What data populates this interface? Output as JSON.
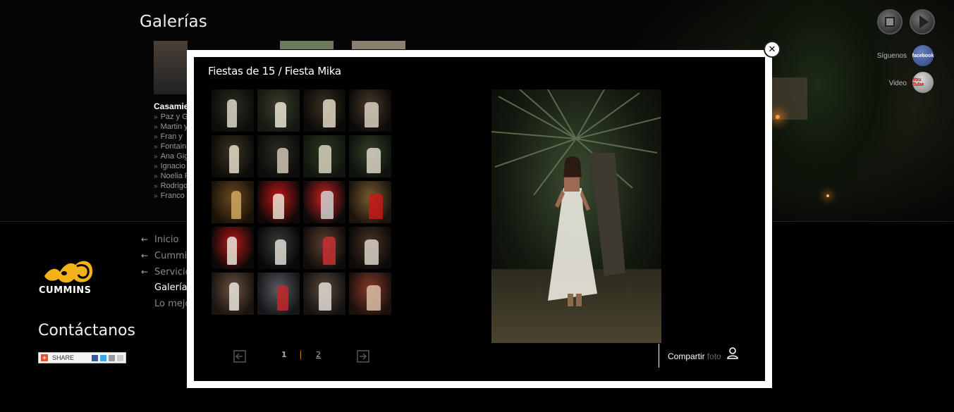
{
  "page": {
    "title": "Galerías"
  },
  "category": {
    "heading": "Casamie",
    "items": [
      "Paz y G",
      "Martin y",
      "Fran y",
      "Fontain",
      "Ana Gig",
      "Ignacio",
      "Noelia F",
      "Rodrigo",
      "Franco"
    ]
  },
  "player": {
    "stop_label": "stop",
    "play_label": "play"
  },
  "social": {
    "follow_label": "Síguenos",
    "facebook_text": "facebook",
    "video_label": "Video",
    "youtube_text": "You Tube"
  },
  "nav": {
    "items": [
      {
        "label": "Inicio",
        "arrow": "←"
      },
      {
        "label": "Cummi",
        "arrow": "←"
      },
      {
        "label": "Servicio",
        "arrow": "←"
      },
      {
        "label": "Galería",
        "arrow": ""
      },
      {
        "label": "Lo mejo",
        "arrow": ""
      }
    ]
  },
  "brand": {
    "logo_text": "CUMMINS",
    "logo_icon": "cummins-logo-icon"
  },
  "contact": {
    "heading": "Contáctanos"
  },
  "share_widget": {
    "label": "SHARE"
  },
  "modal": {
    "title": "Fiestas de 15 / Fiesta Mika",
    "close_glyph": "✕",
    "pager": {
      "current": "1",
      "next_page": "2"
    },
    "share_label": "Compartir",
    "share_label_dim": "foto"
  },
  "thumbnails": [
    "night-garden",
    "night-garden",
    "girl-white-dress",
    "girl-portrait",
    "girl-pose",
    "girl-closeup",
    "girl-leaning",
    "girl-grass",
    "building-night",
    "red-car",
    "red-car",
    "red-car-building",
    "girl-red-car",
    "couple",
    "family-hug",
    "couple-dance",
    "party-table",
    "gifts",
    "guests",
    "group-photo"
  ],
  "colors": {
    "accent_gold": "#b8860b",
    "logo_yellow": "#f3b21a",
    "modal_border": "#ffffff"
  }
}
